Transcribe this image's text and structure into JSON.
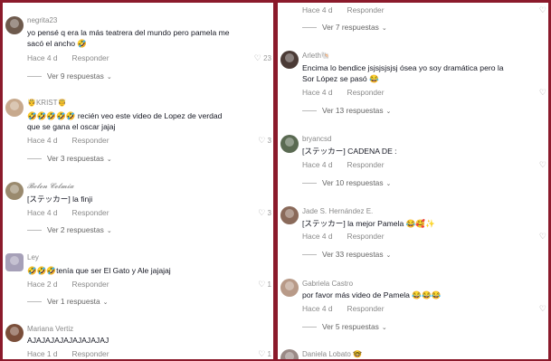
{
  "left": {
    "comments": [
      {
        "username": "negrita23",
        "text": [
          "yo pensé q era la más teatrera del mundo pero pamela me",
          "sacó el ancho 🤣"
        ],
        "time": "Hace 4 d",
        "reply": "Responder",
        "likes": "23",
        "replies": "Ver 9 respuestas"
      },
      {
        "username": "🤴KRIST🤴",
        "text": [
          "🤣🤣🤣🤣🤣 recién veo este video de Lopez de verdad",
          "que se gana el oscar jajaj"
        ],
        "time": "Hace 4 d",
        "reply": "Responder",
        "likes": "3",
        "replies": "Ver 3 respuestas"
      },
      {
        "username": "𝓑𝓮𝓵𝓮𝓷 𝓒𝓮𝓵𝓶𝓲𝓪",
        "text": [
          "[ステッカー] la finji"
        ],
        "time": "Hace 4 d",
        "reply": "Responder",
        "likes": "3",
        "replies": "Ver 2 respuestas"
      },
      {
        "username": "Ley",
        "text": [
          "🤣🤣🤣tenía que ser El Gato y Ale jajajaj"
        ],
        "time": "Hace 2 d",
        "reply": "Responder",
        "likes": "1",
        "replies": "Ver 1 respuesta"
      },
      {
        "username": "Mariana Vertiz",
        "text": [
          "AJAJAJAJAJAJAJAJAJ"
        ],
        "time": "Hace 1 d",
        "reply": "Responder",
        "likes": "1",
        "replies": ""
      }
    ]
  },
  "right": {
    "top": {
      "time": "Hace 4 d",
      "reply": "Responder",
      "replies": "Ver 7 respuestas"
    },
    "comments": [
      {
        "username": "Arleth🐚",
        "text": [
          "Encima lo bendice jsjsjsjsjsj ósea yo soy dramática pero la",
          "Sor López se pasó 😂"
        ],
        "time": "Hace 4 d",
        "reply": "Responder",
        "likes": "",
        "replies": "Ver 13 respuestas"
      },
      {
        "username": "bryancsd",
        "text": [
          "[ステッカー] CADENA DE :"
        ],
        "time": "Hace 4 d",
        "reply": "Responder",
        "likes": "",
        "replies": "Ver 10 respuestas"
      },
      {
        "username": "Jade S. Hernández E.",
        "text": [
          "[ステッカー] la mejor Pamela 😂🥰✨"
        ],
        "time": "Hace 4 d",
        "reply": "Responder",
        "likes": "",
        "replies": "Ver 33 respuestas"
      },
      {
        "username": "Gabriela Castro",
        "text": [
          "por favor más video de Pamela 😂😂😂"
        ],
        "time": "Hace 4 d",
        "reply": "Responder",
        "likes": "",
        "replies": "Ver 5 respuestas"
      },
      {
        "username": "Daniela Lobato 🤓",
        "text": [],
        "time": "",
        "reply": "",
        "likes": "",
        "replies": ""
      }
    ]
  },
  "icons": {
    "like": "heart-outline-icon",
    "expand": "chevron-down-icon"
  },
  "colors": {
    "frame": "#8b1a2b",
    "username": "#8a8a8a",
    "text": "#161823"
  }
}
